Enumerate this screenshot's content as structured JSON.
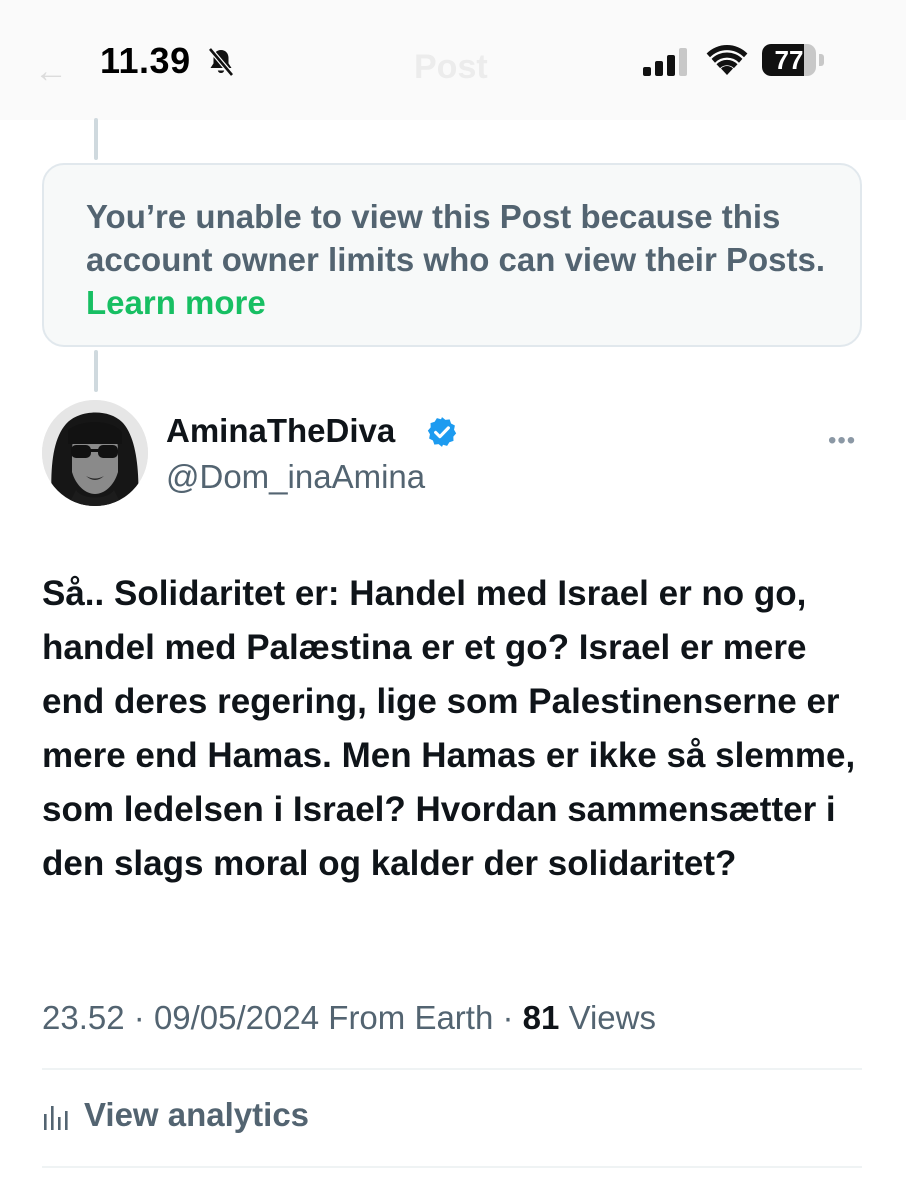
{
  "status_bar": {
    "time": "11.39",
    "battery_level": "77",
    "battery_fraction": 0.77
  },
  "nav": {
    "title": "Post"
  },
  "notice": {
    "text": "You’re unable to view this Post because this account owner limits who can view their Posts. ",
    "link": "Learn more"
  },
  "post": {
    "display_name": "AminaTheDiva",
    "handle": "@Dom_inaAmina",
    "text": "Så.. Solidaritet er: Handel med Israel er no go, handel med Palæstina er et go? Israel er mere end deres regering, lige som Palestinenserne er mere end Hamas. Men Hamas er ikke så slemme, som ledelsen i Israel? Hvordan sammensætter i den slags moral og kalder der solidaritet?",
    "time": "23.52",
    "sep1": "·",
    "date": "09/05/2024",
    "source": "From Earth",
    "sep2": "·",
    "views_count": "81",
    "views_label": "Views"
  },
  "actions": {
    "analytics_label": "View analytics"
  },
  "colors": {
    "accent_link": "#17bf63",
    "verified": "#1d9bf0",
    "muted_text": "#536471"
  }
}
